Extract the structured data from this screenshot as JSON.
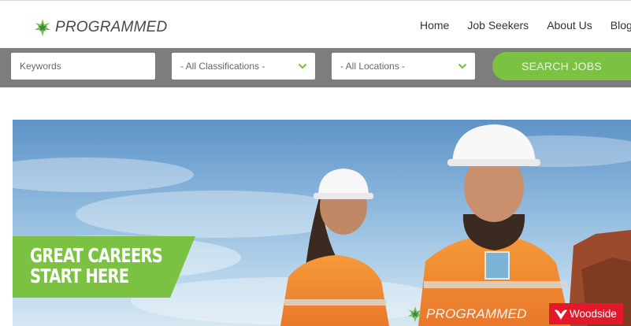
{
  "brand": {
    "name": "PROGRAMMED",
    "color": "#7cc242",
    "star_color_a": "#7cc242",
    "star_color_b": "#2e8b57"
  },
  "nav": {
    "items": [
      {
        "label": "Home"
      },
      {
        "label": "Job Seekers"
      },
      {
        "label": "About Us"
      },
      {
        "label": "Blog"
      }
    ]
  },
  "search": {
    "keywords_placeholder": "Keywords",
    "classification_selected": "- All Classifications -",
    "location_selected": "- All Locations -",
    "button_label": "SEARCH JOBS",
    "bar_color": "#7d7d7d",
    "chevron_icon": "chevron-down-icon"
  },
  "hero": {
    "tagline_line1": "GREAT CAREERS",
    "tagline_line2": "START HERE",
    "tagline_bg": "#7cc242",
    "footer_brand": "PROGRAMMED",
    "partner_label": "Woodside",
    "partner_color": "#e3192b"
  }
}
